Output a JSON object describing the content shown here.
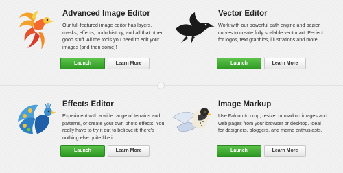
{
  "colors": {
    "launch_green": "#3aa82e",
    "background": "#f3f3f3",
    "title_text": "#222222"
  },
  "apps": [
    {
      "id": "image-editor",
      "title": "Advanced Image Editor",
      "description": "Our full-featured image editor has layers, masks, effects, undo history, and all that other good stuff. All the tools you need to edit your images (and then some)!",
      "icon": "phoenix-icon",
      "launch_label": "Launch",
      "more_label": "Learn More"
    },
    {
      "id": "vector-editor",
      "title": "Vector Editor",
      "description": "Work with our powerful path engine and bezier curves to create fully scalable vector art. Perfect for logos, text graphics, illustrations and more.",
      "icon": "raven-icon",
      "launch_label": "Launch",
      "more_label": "Learn More"
    },
    {
      "id": "effects-editor",
      "title": "Effects Editor",
      "description": "Experiment with a wide range of terrains and patterns, or create your own photo effects. You really have to try it out to believe it; there's nothing else quite like it.",
      "icon": "peacock-icon",
      "launch_label": "Launch",
      "more_label": "Learn More"
    },
    {
      "id": "image-markup",
      "title": "Image Markup",
      "description": "Use Falcon to crop, resize, or markup images and web pages from your browser or desktop. Ideal for designers, bloggers, and meme enthusiasts.",
      "icon": "falcon-icon",
      "launch_label": "Launch",
      "more_label": "Learn More"
    }
  ]
}
